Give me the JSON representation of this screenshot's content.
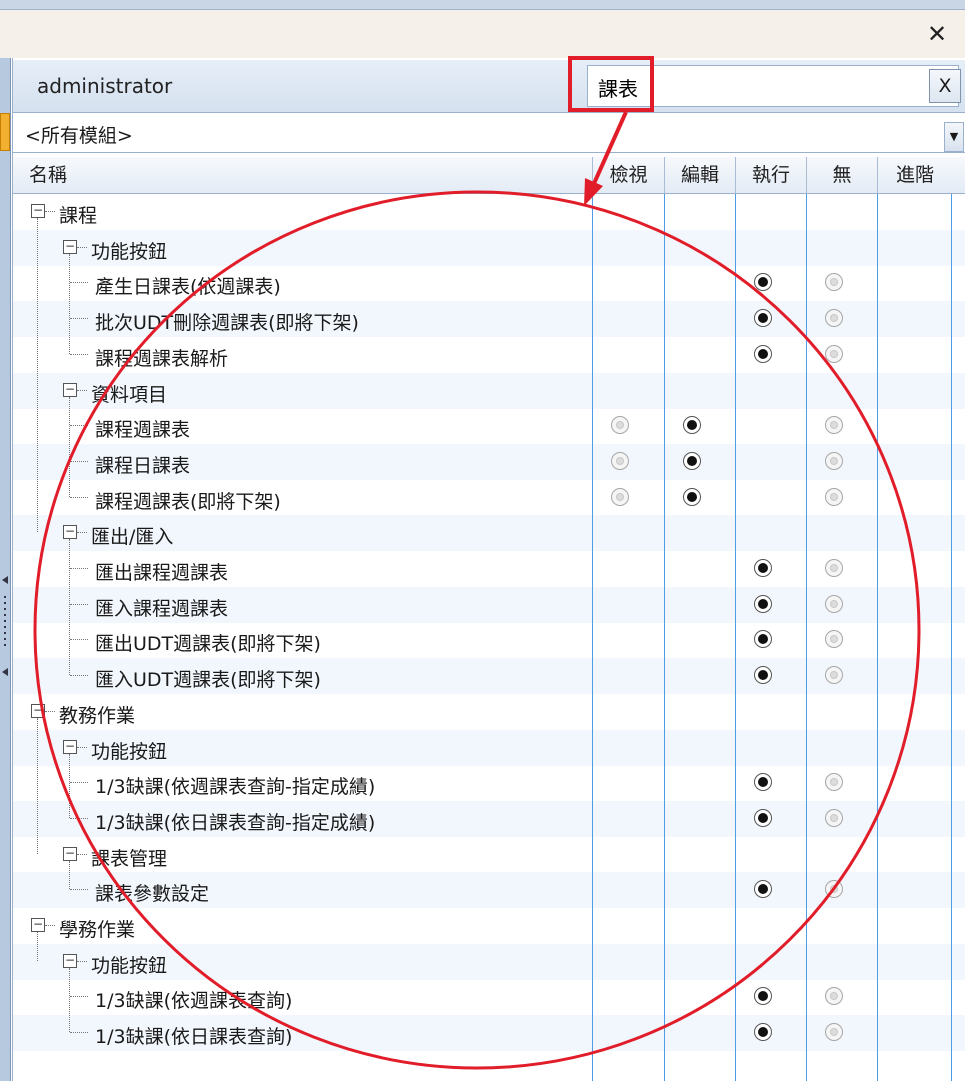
{
  "dialog": {
    "close_icon": "close-icon"
  },
  "user": {
    "name": "administrator"
  },
  "search": {
    "value": "課表",
    "clear_label": "X"
  },
  "module_select": {
    "value": "<所有模組>"
  },
  "columns": {
    "name": "名稱",
    "view": "檢視",
    "edit": "編輯",
    "execute": "執行",
    "none": "無",
    "advanced": "進階"
  },
  "tree": [
    {
      "level": 0,
      "label": "課程",
      "expander": "minus"
    },
    {
      "level": 1,
      "label": "功能按鈕",
      "expander": "minus"
    },
    {
      "level": 2,
      "label": "產生日課表(依週課表)",
      "view": null,
      "edit": null,
      "execute": "on",
      "none": "off"
    },
    {
      "level": 2,
      "label": "批次UDT刪除週課表(即將下架)",
      "view": null,
      "edit": null,
      "execute": "on",
      "none": "off"
    },
    {
      "level": 2,
      "label": "課程週課表解析",
      "view": null,
      "edit": null,
      "execute": "on",
      "none": "off"
    },
    {
      "level": 1,
      "label": "資料項目",
      "expander": "minus"
    },
    {
      "level": 2,
      "label": "課程週課表",
      "view": "off",
      "edit": "on",
      "execute": null,
      "none": "off"
    },
    {
      "level": 2,
      "label": "課程日課表",
      "view": "off",
      "edit": "on",
      "execute": null,
      "none": "off"
    },
    {
      "level": 2,
      "label": "課程週課表(即將下架)",
      "view": "off",
      "edit": "on",
      "execute": null,
      "none": "off"
    },
    {
      "level": 1,
      "label": "匯出/匯入",
      "expander": "minus"
    },
    {
      "level": 2,
      "label": "匯出課程週課表",
      "view": null,
      "edit": null,
      "execute": "on",
      "none": "off"
    },
    {
      "level": 2,
      "label": "匯入課程週課表",
      "view": null,
      "edit": null,
      "execute": "on",
      "none": "off"
    },
    {
      "level": 2,
      "label": "匯出UDT週課表(即將下架)",
      "view": null,
      "edit": null,
      "execute": "on",
      "none": "off"
    },
    {
      "level": 2,
      "label": "匯入UDT週課表(即將下架)",
      "view": null,
      "edit": null,
      "execute": "on",
      "none": "off"
    },
    {
      "level": 0,
      "label": "教務作業",
      "expander": "minus"
    },
    {
      "level": 1,
      "label": "功能按鈕",
      "expander": "minus"
    },
    {
      "level": 2,
      "label": "1/3缺課(依週課表查詢-指定成績)",
      "view": null,
      "edit": null,
      "execute": "on",
      "none": "off"
    },
    {
      "level": 2,
      "label": "1/3缺課(依日課表查詢-指定成績)",
      "view": null,
      "edit": null,
      "execute": "on",
      "none": "off"
    },
    {
      "level": 1,
      "label": "課表管理",
      "expander": "minus"
    },
    {
      "level": 2,
      "label": "課表參數設定",
      "view": null,
      "edit": null,
      "execute": "on",
      "none": "off"
    },
    {
      "level": 0,
      "label": "學務作業",
      "expander": "minus"
    },
    {
      "level": 1,
      "label": "功能按鈕",
      "expander": "minus"
    },
    {
      "level": 2,
      "label": "1/3缺課(依週課表查詢)",
      "view": null,
      "edit": null,
      "execute": "on",
      "none": "off"
    },
    {
      "level": 2,
      "label": "1/3缺課(依日課表查詢)",
      "view": null,
      "edit": null,
      "execute": "on",
      "none": "off"
    }
  ],
  "annotation": {
    "color": "#e11d2a",
    "shapes": [
      "highlight-box",
      "arrow",
      "circle"
    ]
  },
  "colors": {
    "gridline": "#4e9be6",
    "alt_row": "#f2f7fd"
  }
}
